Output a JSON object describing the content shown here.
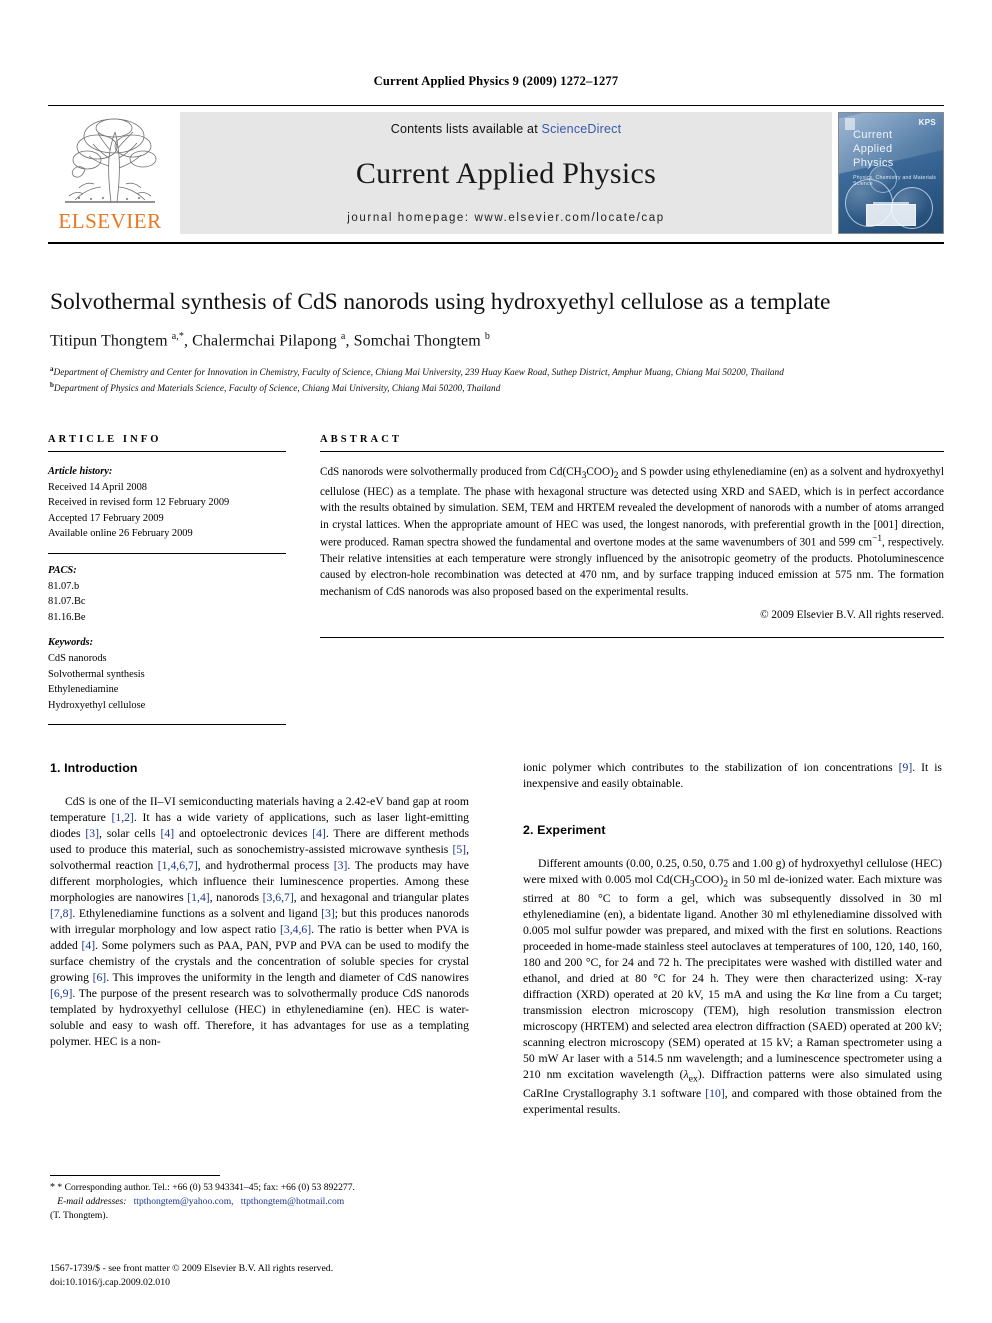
{
  "running_head": "Current Applied Physics  9 (2009) 1272–1277",
  "masthead": {
    "contents_prefix": "Contents lists available at ",
    "sciencedirect": "ScienceDirect",
    "journal_title": "Current Applied Physics",
    "homepage": "journal homepage: www.elsevier.com/locate/cap",
    "publisher": "ELSEVIER",
    "cover": {
      "title": "Current\nApplied\nPhysics",
      "subtitle": "Physics, Chemistry and Materials Science",
      "society": "KPS"
    },
    "link_color": "#3858a8",
    "publisher_color": "#E87722"
  },
  "article": {
    "title": "Solvothermal synthesis of CdS nanorods using hydroxyethyl cellulose as a template",
    "authors": "Titipun Thongtem a,*, Chalermchai Pilapong a, Somchai Thongtem b",
    "affiliation_a": "Department of Chemistry and Center for Innovation in Chemistry, Faculty of Science, Chiang Mai University, 239 Huay Kaew Road, Suthep District, Amphur Muang, Chiang Mai 50200, Thailand",
    "affiliation_b": "Department of Physics and Materials Science, Faculty of Science, Chiang Mai University, Chiang Mai 50200, Thailand"
  },
  "panel": {
    "info_heading": "ARTICLE INFO",
    "abstract_heading": "ABSTRACT",
    "history_label": "Article history:",
    "history": [
      "Received 14 April 2008",
      "Received in revised form 12 February 2009",
      "Accepted 17 February 2009",
      "Available online 26 February 2009"
    ],
    "pacs_label": "PACS:",
    "pacs": [
      "81.07.b",
      "81.07.Bc",
      "81.16.Be"
    ],
    "keywords_label": "Keywords:",
    "keywords": [
      "CdS nanorods",
      "Solvothermal synthesis",
      "Ethylenediamine",
      "Hydroxyethyl cellulose"
    ],
    "abstract": "CdS nanorods were solvothermally produced from Cd(CH3COO)2 and S powder using ethylenediamine (en) as a solvent and hydroxyethyl cellulose (HEC) as a template. The phase with hexagonal structure was detected using XRD and SAED, which is in perfect accordance with the results obtained by simulation. SEM, TEM and HRTEM revealed the development of nanorods with a number of atoms arranged in crystal lattices. When the appropriate amount of HEC was used, the longest nanorods, with preferential growth in the [001] direction, were produced. Raman spectra showed the fundamental and overtone modes at the same wavenumbers of 301 and 599 cm−1, respectively. Their relative intensities at each temperature were strongly influenced by the anisotropic geometry of the products. Photoluminescence caused by electron-hole recombination was detected at 470 nm, and by surface trapping induced emission at 575 nm. The formation mechanism of CdS nanorods was also proposed based on the experimental results.",
    "copyright": "© 2009 Elsevier B.V. All rights reserved."
  },
  "sections": {
    "introduction_heading": "1. Introduction",
    "introduction_p1": "CdS is one of the II–VI semiconducting materials having a 2.42-eV band gap at room temperature [1,2]. It has a wide variety of applications, such as laser light-emitting diodes [3], solar cells [4] and optoelectronic devices [4]. There are different methods used to produce this material, such as sonochemistry-assisted microwave synthesis [5], solvothermal reaction [1,4,6,7], and hydrothermal process [3]. The products may have different morphologies, which influence their luminescence properties. Among these morphologies are nanowires [1,4], nanorods [3,6,7], and hexagonal and triangular plates [7,8]. Ethylenediamine functions as a solvent and ligand [3]; but this produces nanorods with irregular morphology and low aspect ratio [3,4,6]. The ratio is better when PVA is added [4]. Some polymers such as PAA, PAN, PVP and PVA can be used to modify the surface chemistry of the crystals and the concentration of soluble species for crystal growing [6]. This improves the uniformity in the length and diameter of CdS nanowires [6,9]. The purpose of the present research was to solvothermally produce CdS nanorods templated by hydroxyethyl cellulose (HEC) in ethylenediamine (en). HEC is water-soluble and easy to wash off. Therefore, it has advantages for use as a templating polymer. HEC is a non-ionic polymer which contributes to the stabilization of ion concentrations [9]. It is inexpensive and easily obtainable.",
    "experiment_heading": "2. Experiment",
    "experiment_p1": "Different amounts (0.00, 0.25, 0.50, 0.75 and 1.00 g) of hydroxyethyl cellulose (HEC) were mixed with 0.005 mol Cd(CH3COO)2 in 50 ml de-ionized water. Each mixture was stirred at 80 °C to form a gel, which was subsequently dissolved in 30 ml ethylenediamine (en), a bidentate ligand. Another 30 ml ethylenediamine dissolved with 0.005 mol sulfur powder was prepared, and mixed with the first en solutions. Reactions proceeded in home-made stainless steel autoclaves at temperatures of 100, 120, 140, 160, 180 and 200 °C, for 24 and 72 h. The precipitates were washed with distilled water and ethanol, and dried at 80 °C for 24 h. They were then characterized using: X-ray diffraction (XRD) operated at 20 kV, 15 mA and using the Kα line from a Cu target; transmission electron microscopy (TEM), high resolution transmission electron microscopy (HRTEM) and selected area electron diffraction (SAED) operated at 200 kV; scanning electron microscopy (SEM) operated at 15 kV; a Raman spectrometer using a 50 mW Ar laser with a 514.5 nm wavelength; and a luminescence spectrometer using a 210 nm excitation wavelength (λex). Diffraction patterns were also simulated using CaRIne Crystallography 3.1 software [10], and compared with those obtained from the experimental results."
  },
  "footnotes": {
    "corresponding": "* Corresponding author. Tel.: +66 (0) 53 943341–45; fax: +66 (0) 53 892277.",
    "email_label": "E-mail addresses:",
    "email1": "ttpthongtem@yahoo.com,",
    "email2": "ttpthongtem@hotmail.com",
    "email_owner": "(T. Thongtem).",
    "issn_line": "1567-1739/$ - see front matter © 2009 Elsevier B.V. All rights reserved.",
    "doi_line": "doi:10.1016/j.cap.2009.02.010"
  }
}
